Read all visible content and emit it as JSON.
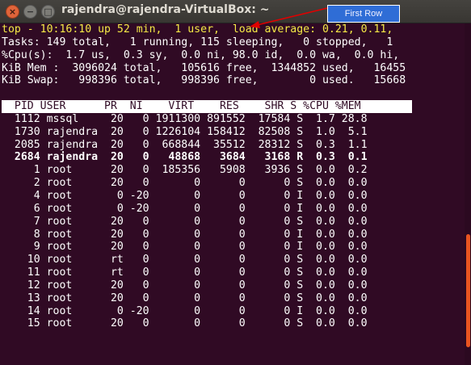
{
  "window": {
    "title": "rajendra@rajendra-VirtualBox: ~",
    "close_glyph": "×",
    "minimize_glyph": "−",
    "maximize_glyph": "□"
  },
  "annotation": {
    "label": "First Row",
    "color": "#e00000"
  },
  "top": {
    "line1": "top - 10:16:10 up 52 min,  1 user,  load average: 0.21, 0.11,",
    "line2": "Tasks: 149 total,   1 running, 115 sleeping,   0 stopped,   1",
    "line3": "%Cpu(s):  1.7 us,  0.3 sy,  0.0 ni, 98.0 id,  0.0 wa,  0.0 hi,",
    "line4": "KiB Mem :  3096024 total,   105616 free,  1344852 used,   16455",
    "line5": "KiB Swap:   998396 total,   998396 free,        0 used.   15668",
    "header": "  PID USER      PR  NI    VIRT    RES    SHR S %CPU %MEM        ",
    "processes": [
      "  1112 mssql     20   0 1911300 891552  17584 S  1.7 28.8",
      "  1730 rajendra  20   0 1226104 158412  82508 S  1.0  5.1",
      "  2085 rajendra  20   0  668844  35512  28312 S  0.3  1.1",
      "  2684 rajendra  20   0   48868   3684   3168 R  0.3  0.1",
      "     1 root      20   0  185356   5908   3936 S  0.0  0.2",
      "     2 root      20   0       0      0      0 S  0.0  0.0",
      "     4 root       0 -20       0      0      0 I  0.0  0.0",
      "     6 root       0 -20       0      0      0 I  0.0  0.0",
      "     7 root      20   0       0      0      0 S  0.0  0.0",
      "     8 root      20   0       0      0      0 I  0.0  0.0",
      "     9 root      20   0       0      0      0 I  0.0  0.0",
      "    10 root      rt   0       0      0      0 S  0.0  0.0",
      "    11 root      rt   0       0      0      0 S  0.0  0.0",
      "    12 root      20   0       0      0      0 S  0.0  0.0",
      "    13 root      20   0       0      0      0 S  0.0  0.0",
      "    14 root       0 -20       0      0      0 I  0.0  0.0",
      "    15 root      20   0       0      0      0 S  0.0  0.0"
    ]
  }
}
